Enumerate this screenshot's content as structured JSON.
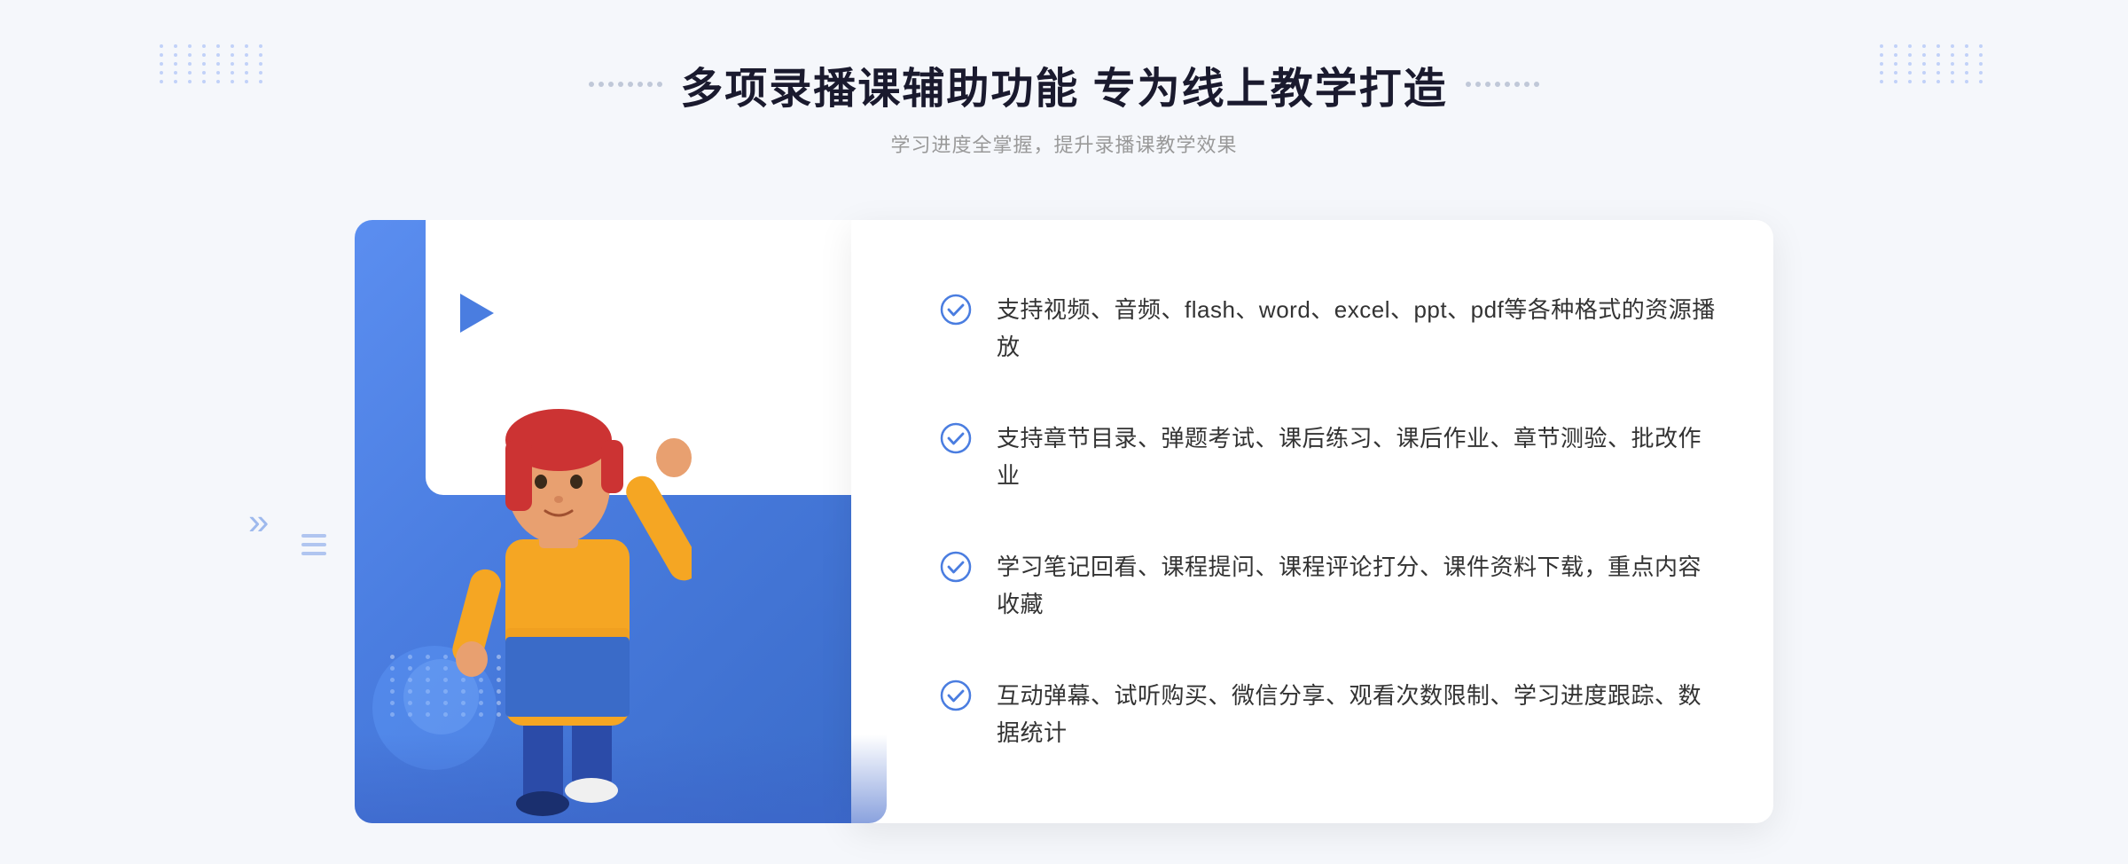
{
  "header": {
    "title": "多项录播课辅助功能 专为线上教学打造",
    "subtitle": "学习进度全掌握，提升录播课教学效果"
  },
  "features": [
    {
      "id": "feature-1",
      "text": "支持视频、音频、flash、word、excel、ppt、pdf等各种格式的资源播放"
    },
    {
      "id": "feature-2",
      "text": "支持章节目录、弹题考试、课后练习、课后作业、章节测验、批改作业"
    },
    {
      "id": "feature-3",
      "text": "学习笔记回看、课程提问、课程评论打分、课件资料下载，重点内容收藏"
    },
    {
      "id": "feature-4",
      "text": "互动弹幕、试听购买、微信分享、观看次数限制、学习进度跟踪、数据统计"
    }
  ],
  "colors": {
    "primary": "#4a7de0",
    "check": "#4a7de0",
    "text_dark": "#1a1a2e",
    "text_gray": "#999999",
    "bg": "#f5f7fb"
  },
  "icons": {
    "check": "check-circle-icon",
    "play": "play-icon",
    "chevron_left": "«"
  }
}
